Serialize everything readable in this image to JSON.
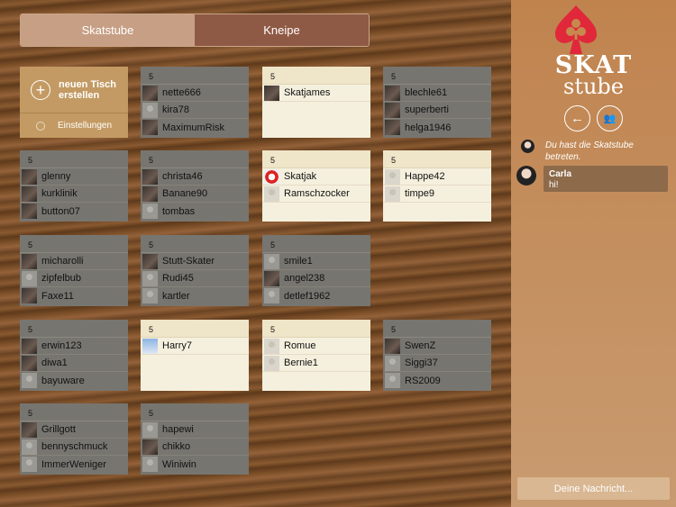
{
  "tabs": [
    {
      "label": "Skatstube",
      "active": true
    },
    {
      "label": "Kneipe",
      "active": false
    }
  ],
  "menu": {
    "new_table": "neuen Tisch erstellen",
    "settings": "Einstellungen"
  },
  "tables": [
    {
      "count": "5",
      "open": false,
      "players": [
        {
          "name": "nette666",
          "avatar": "photo"
        },
        {
          "name": "kira78",
          "avatar": "default"
        },
        {
          "name": "MaximumRisk",
          "avatar": "photo"
        }
      ]
    },
    {
      "count": "5",
      "open": true,
      "players": [
        {
          "name": "Skatjames",
          "avatar": "photo"
        }
      ]
    },
    {
      "count": "5",
      "open": false,
      "players": [
        {
          "name": "blechle61",
          "avatar": "photo"
        },
        {
          "name": "superberti",
          "avatar": "photo"
        },
        {
          "name": "helga1946",
          "avatar": "photo"
        }
      ]
    },
    {
      "count": "5",
      "open": false,
      "players": [
        {
          "name": "glenny",
          "avatar": "photo"
        },
        {
          "name": "kurklinik",
          "avatar": "photo"
        },
        {
          "name": "button07",
          "avatar": "photo"
        }
      ]
    },
    {
      "count": "5",
      "open": false,
      "players": [
        {
          "name": "christa46",
          "avatar": "photo"
        },
        {
          "name": "Banane90",
          "avatar": "photo"
        },
        {
          "name": "tombas",
          "avatar": "default"
        }
      ]
    },
    {
      "count": "5",
      "open": true,
      "players": [
        {
          "name": "Skatjak",
          "avatar": "logo"
        },
        {
          "name": "Ramschzocker",
          "avatar": "default"
        }
      ]
    },
    {
      "count": "5",
      "open": true,
      "players": [
        {
          "name": "Happe42",
          "avatar": "default"
        },
        {
          "name": "timpe9",
          "avatar": "default"
        }
      ]
    },
    {
      "count": "5",
      "open": false,
      "players": [
        {
          "name": "micharolli",
          "avatar": "photo"
        },
        {
          "name": "zipfelbub",
          "avatar": "default"
        },
        {
          "name": "Faxe11",
          "avatar": "photo"
        }
      ]
    },
    {
      "count": "5",
      "open": false,
      "players": [
        {
          "name": "Stutt-Skater",
          "avatar": "photo"
        },
        {
          "name": "Rudi45",
          "avatar": "default"
        },
        {
          "name": "kartler",
          "avatar": "default"
        }
      ]
    },
    {
      "count": "5",
      "open": false,
      "players": [
        {
          "name": "smile1",
          "avatar": "default"
        },
        {
          "name": "angel238",
          "avatar": "photo"
        },
        {
          "name": "detlef1962",
          "avatar": "default"
        }
      ]
    },
    null,
    {
      "count": "5",
      "open": false,
      "players": [
        {
          "name": "erwin123",
          "avatar": "photo"
        },
        {
          "name": "diwa1",
          "avatar": "photo"
        },
        {
          "name": "bayuware",
          "avatar": "default"
        }
      ]
    },
    {
      "count": "5",
      "open": true,
      "players": [
        {
          "name": "Harry7",
          "avatar": "sky"
        }
      ]
    },
    {
      "count": "5",
      "open": true,
      "players": [
        {
          "name": "Romue",
          "avatar": "default"
        },
        {
          "name": "Bernie1",
          "avatar": "default"
        }
      ]
    },
    {
      "count": "5",
      "open": false,
      "players": [
        {
          "name": "SwenZ",
          "avatar": "photo"
        },
        {
          "name": "Siggi37",
          "avatar": "default"
        },
        {
          "name": "RS2009",
          "avatar": "default"
        }
      ]
    },
    {
      "count": "5",
      "open": false,
      "players": [
        {
          "name": "Grillgott",
          "avatar": "photo"
        },
        {
          "name": "bennyschmuck",
          "avatar": "default"
        },
        {
          "name": "ImmerWeniger",
          "avatar": "default"
        }
      ]
    },
    {
      "count": "5",
      "open": false,
      "players": [
        {
          "name": "hapewi",
          "avatar": "default"
        },
        {
          "name": "chikko",
          "avatar": "photo"
        },
        {
          "name": "Winiwin",
          "avatar": "default"
        }
      ]
    }
  ],
  "brand": {
    "line1": "SKAT",
    "line2": "stube",
    "color": "#e0283a"
  },
  "chat": {
    "system": "Du hast die Skatstube betreten.",
    "messages": [
      {
        "author": "Carla",
        "text": "hi!"
      }
    ],
    "placeholder": "Deine Nachricht..."
  }
}
